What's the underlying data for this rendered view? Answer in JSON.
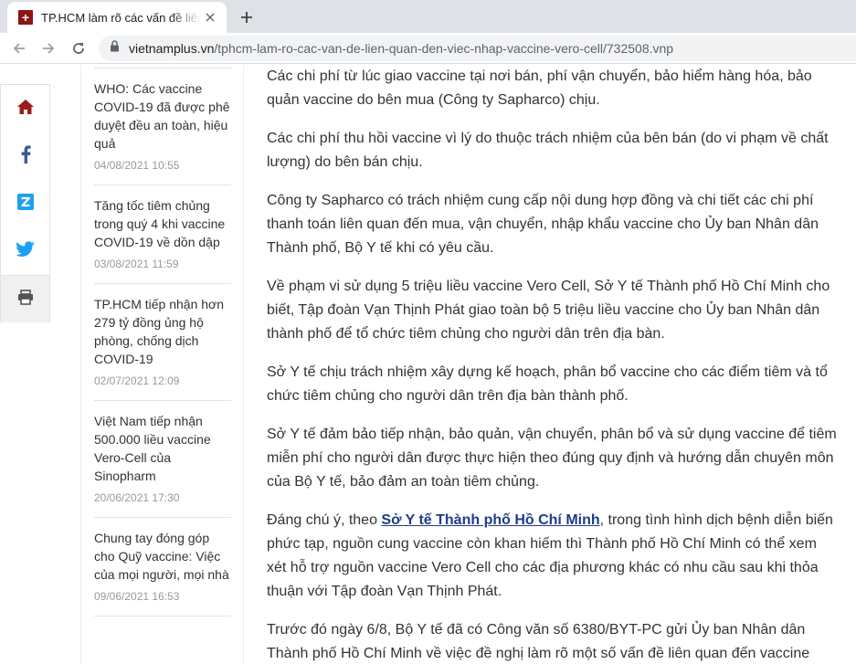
{
  "browser": {
    "tab_title": "TP.HCM làm rõ các vấn đề liên quan đến việc nhập vaccine Vero Cell",
    "favicon_text": "+",
    "url_domain": "vietnamplus.vn",
    "url_path": "/tphcm-lam-ro-cac-van-de-lien-quan-den-viec-nhap-vaccine-vero-cell/732508.vnp"
  },
  "share_bar": {
    "items": [
      {
        "name": "home",
        "icon": "home-icon",
        "color": "#9b1c1c"
      },
      {
        "name": "facebook",
        "icon": "facebook-icon",
        "color": "#3b5998"
      },
      {
        "name": "zalo",
        "icon": "zalo-icon",
        "color": "#1da1f2"
      },
      {
        "name": "twitter",
        "icon": "twitter-icon",
        "color": "#1da1f2"
      },
      {
        "name": "print",
        "icon": "print-icon",
        "color": "#555555"
      }
    ]
  },
  "sidebar": {
    "top_fragment": "...",
    "items": [
      {
        "title": "WHO: Các vaccine COVID-19 đã được phê duyệt đều an toàn, hiệu quả",
        "date": "04/08/2021 10:55"
      },
      {
        "title": "Tăng tốc tiêm chủng trong quý 4 khi vaccine COVID-19 về dồn dập",
        "date": "03/08/2021 11:59"
      },
      {
        "title": "TP.HCM tiếp nhận hơn 279 tỷ đồng ủng hộ phòng, chống dịch COVID-19",
        "date": "02/07/2021 12:09"
      },
      {
        "title": "Việt Nam tiếp nhận 500.000 liều vaccine Vero-Cell của Sinopharm",
        "date": "20/06/2021 17:30"
      },
      {
        "title": "Chung tay đóng góp cho Quỹ vaccine: Việc của mọi người, mọi nhà",
        "date": "09/06/2021 16:53"
      }
    ]
  },
  "article": {
    "p1": "Các chi phí từ lúc giao vaccine tại nơi bán, phí vận chuyển, bảo hiểm hàng hóa, bảo quản vaccine do bên mua (Công ty Sapharco) chịu.",
    "p2": "Các chi phí thu hồi vaccine vì lý do thuộc trách nhiệm của bên bán (do vi phạm về chất lượng) do bên bán chịu.",
    "p3": "Công ty Sapharco có trách nhiệm cung cấp nội dung hợp đồng và chi tiết các chi phí thanh toán liên quan đến mua, vận chuyển, nhập khẩu vaccine cho Ủy ban Nhân dân Thành phố, Bộ Y tế khi có yêu cầu.",
    "p4": "Về phạm vi sử dụng 5 triệu liều vaccine Vero Cell, Sở Y tế Thành phố Hồ Chí Minh cho biết, Tập đoàn Vạn Thịnh Phát giao toàn bộ 5 triệu liều vaccine cho Ủy ban Nhân dân thành phố để tổ chức tiêm chủng cho người dân trên địa bàn.",
    "p5": "Sở Y tế chịu trách nhiệm xây dựng kế hoạch, phân bổ vaccine cho các điểm tiêm và tổ chức tiêm chủng cho người dân trên địa bàn thành phố.",
    "p6": "Sở Y tế đảm bảo tiếp nhận, bảo quản, vận chuyển, phân bổ và sử dụng vaccine để tiêm miễn phí cho người dân được thực hiện theo đúng quy định và hướng dẫn chuyên môn của Bộ Y tế, bảo đảm an toàn tiêm chủng.",
    "p7_before": "Đáng chú ý, theo ",
    "p7_link": "Sở Y tế Thành phố Hồ Chí Minh",
    "p7_after": ", trong tình hình dịch bệnh diễn biến phức tạp, nguồn cung vaccine còn khan hiếm thì Thành phố Hồ Chí Minh có thể xem xét hỗ trợ nguồn vaccine Vero Cell cho các địa phương khác có nhu cầu sau khi thỏa thuận với Tập đoàn Vạn Thịnh Phát.",
    "p8": "Trước đó ngày 6/8, Bộ Y tế đã có Công văn số 6380/BYT-PC gửi Ủy ban Nhân dân Thành phố Hồ Chí Minh về việc đề nghị làm rõ một số vấn đề liên quan đến vaccine"
  }
}
